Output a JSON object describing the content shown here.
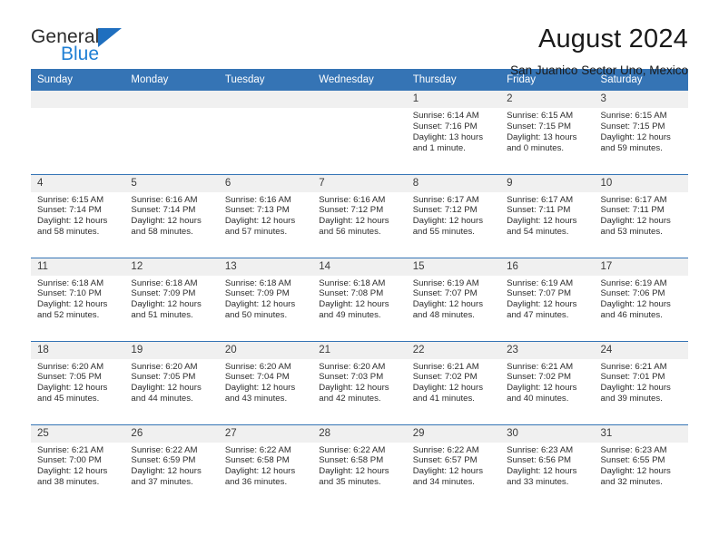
{
  "brand": {
    "line1": "General",
    "line2": "Blue",
    "flag_color": "#1f6fbf",
    "blue_text_color": "#1f7fd4"
  },
  "header": {
    "title": "August 2024",
    "subtitle": "San Juanico Sector Uno, Mexico"
  },
  "theme": {
    "header_blue": "#3574b5",
    "daynum_gray": "#f0f0f0"
  },
  "weekday_headers": [
    "Sunday",
    "Monday",
    "Tuesday",
    "Wednesday",
    "Thursday",
    "Friday",
    "Saturday"
  ],
  "weeks": [
    [
      {
        "day": "",
        "empty": true,
        "sunrise": "",
        "sunset": "",
        "daylight1": "",
        "daylight2": ""
      },
      {
        "day": "",
        "empty": true,
        "sunrise": "",
        "sunset": "",
        "daylight1": "",
        "daylight2": ""
      },
      {
        "day": "",
        "empty": true,
        "sunrise": "",
        "sunset": "",
        "daylight1": "",
        "daylight2": ""
      },
      {
        "day": "",
        "empty": true,
        "sunrise": "",
        "sunset": "",
        "daylight1": "",
        "daylight2": ""
      },
      {
        "day": "1",
        "empty": false,
        "sunrise": "Sunrise: 6:14 AM",
        "sunset": "Sunset: 7:16 PM",
        "daylight1": "Daylight: 13 hours",
        "daylight2": "and 1 minute."
      },
      {
        "day": "2",
        "empty": false,
        "sunrise": "Sunrise: 6:15 AM",
        "sunset": "Sunset: 7:15 PM",
        "daylight1": "Daylight: 13 hours",
        "daylight2": "and 0 minutes."
      },
      {
        "day": "3",
        "empty": false,
        "sunrise": "Sunrise: 6:15 AM",
        "sunset": "Sunset: 7:15 PM",
        "daylight1": "Daylight: 12 hours",
        "daylight2": "and 59 minutes."
      }
    ],
    [
      {
        "day": "4",
        "empty": false,
        "sunrise": "Sunrise: 6:15 AM",
        "sunset": "Sunset: 7:14 PM",
        "daylight1": "Daylight: 12 hours",
        "daylight2": "and 58 minutes."
      },
      {
        "day": "5",
        "empty": false,
        "sunrise": "Sunrise: 6:16 AM",
        "sunset": "Sunset: 7:14 PM",
        "daylight1": "Daylight: 12 hours",
        "daylight2": "and 58 minutes."
      },
      {
        "day": "6",
        "empty": false,
        "sunrise": "Sunrise: 6:16 AM",
        "sunset": "Sunset: 7:13 PM",
        "daylight1": "Daylight: 12 hours",
        "daylight2": "and 57 minutes."
      },
      {
        "day": "7",
        "empty": false,
        "sunrise": "Sunrise: 6:16 AM",
        "sunset": "Sunset: 7:12 PM",
        "daylight1": "Daylight: 12 hours",
        "daylight2": "and 56 minutes."
      },
      {
        "day": "8",
        "empty": false,
        "sunrise": "Sunrise: 6:17 AM",
        "sunset": "Sunset: 7:12 PM",
        "daylight1": "Daylight: 12 hours",
        "daylight2": "and 55 minutes."
      },
      {
        "day": "9",
        "empty": false,
        "sunrise": "Sunrise: 6:17 AM",
        "sunset": "Sunset: 7:11 PM",
        "daylight1": "Daylight: 12 hours",
        "daylight2": "and 54 minutes."
      },
      {
        "day": "10",
        "empty": false,
        "sunrise": "Sunrise: 6:17 AM",
        "sunset": "Sunset: 7:11 PM",
        "daylight1": "Daylight: 12 hours",
        "daylight2": "and 53 minutes."
      }
    ],
    [
      {
        "day": "11",
        "empty": false,
        "sunrise": "Sunrise: 6:18 AM",
        "sunset": "Sunset: 7:10 PM",
        "daylight1": "Daylight: 12 hours",
        "daylight2": "and 52 minutes."
      },
      {
        "day": "12",
        "empty": false,
        "sunrise": "Sunrise: 6:18 AM",
        "sunset": "Sunset: 7:09 PM",
        "daylight1": "Daylight: 12 hours",
        "daylight2": "and 51 minutes."
      },
      {
        "day": "13",
        "empty": false,
        "sunrise": "Sunrise: 6:18 AM",
        "sunset": "Sunset: 7:09 PM",
        "daylight1": "Daylight: 12 hours",
        "daylight2": "and 50 minutes."
      },
      {
        "day": "14",
        "empty": false,
        "sunrise": "Sunrise: 6:18 AM",
        "sunset": "Sunset: 7:08 PM",
        "daylight1": "Daylight: 12 hours",
        "daylight2": "and 49 minutes."
      },
      {
        "day": "15",
        "empty": false,
        "sunrise": "Sunrise: 6:19 AM",
        "sunset": "Sunset: 7:07 PM",
        "daylight1": "Daylight: 12 hours",
        "daylight2": "and 48 minutes."
      },
      {
        "day": "16",
        "empty": false,
        "sunrise": "Sunrise: 6:19 AM",
        "sunset": "Sunset: 7:07 PM",
        "daylight1": "Daylight: 12 hours",
        "daylight2": "and 47 minutes."
      },
      {
        "day": "17",
        "empty": false,
        "sunrise": "Sunrise: 6:19 AM",
        "sunset": "Sunset: 7:06 PM",
        "daylight1": "Daylight: 12 hours",
        "daylight2": "and 46 minutes."
      }
    ],
    [
      {
        "day": "18",
        "empty": false,
        "sunrise": "Sunrise: 6:20 AM",
        "sunset": "Sunset: 7:05 PM",
        "daylight1": "Daylight: 12 hours",
        "daylight2": "and 45 minutes."
      },
      {
        "day": "19",
        "empty": false,
        "sunrise": "Sunrise: 6:20 AM",
        "sunset": "Sunset: 7:05 PM",
        "daylight1": "Daylight: 12 hours",
        "daylight2": "and 44 minutes."
      },
      {
        "day": "20",
        "empty": false,
        "sunrise": "Sunrise: 6:20 AM",
        "sunset": "Sunset: 7:04 PM",
        "daylight1": "Daylight: 12 hours",
        "daylight2": "and 43 minutes."
      },
      {
        "day": "21",
        "empty": false,
        "sunrise": "Sunrise: 6:20 AM",
        "sunset": "Sunset: 7:03 PM",
        "daylight1": "Daylight: 12 hours",
        "daylight2": "and 42 minutes."
      },
      {
        "day": "22",
        "empty": false,
        "sunrise": "Sunrise: 6:21 AM",
        "sunset": "Sunset: 7:02 PM",
        "daylight1": "Daylight: 12 hours",
        "daylight2": "and 41 minutes."
      },
      {
        "day": "23",
        "empty": false,
        "sunrise": "Sunrise: 6:21 AM",
        "sunset": "Sunset: 7:02 PM",
        "daylight1": "Daylight: 12 hours",
        "daylight2": "and 40 minutes."
      },
      {
        "day": "24",
        "empty": false,
        "sunrise": "Sunrise: 6:21 AM",
        "sunset": "Sunset: 7:01 PM",
        "daylight1": "Daylight: 12 hours",
        "daylight2": "and 39 minutes."
      }
    ],
    [
      {
        "day": "25",
        "empty": false,
        "sunrise": "Sunrise: 6:21 AM",
        "sunset": "Sunset: 7:00 PM",
        "daylight1": "Daylight: 12 hours",
        "daylight2": "and 38 minutes."
      },
      {
        "day": "26",
        "empty": false,
        "sunrise": "Sunrise: 6:22 AM",
        "sunset": "Sunset: 6:59 PM",
        "daylight1": "Daylight: 12 hours",
        "daylight2": "and 37 minutes."
      },
      {
        "day": "27",
        "empty": false,
        "sunrise": "Sunrise: 6:22 AM",
        "sunset": "Sunset: 6:58 PM",
        "daylight1": "Daylight: 12 hours",
        "daylight2": "and 36 minutes."
      },
      {
        "day": "28",
        "empty": false,
        "sunrise": "Sunrise: 6:22 AM",
        "sunset": "Sunset: 6:58 PM",
        "daylight1": "Daylight: 12 hours",
        "daylight2": "and 35 minutes."
      },
      {
        "day": "29",
        "empty": false,
        "sunrise": "Sunrise: 6:22 AM",
        "sunset": "Sunset: 6:57 PM",
        "daylight1": "Daylight: 12 hours",
        "daylight2": "and 34 minutes."
      },
      {
        "day": "30",
        "empty": false,
        "sunrise": "Sunrise: 6:23 AM",
        "sunset": "Sunset: 6:56 PM",
        "daylight1": "Daylight: 12 hours",
        "daylight2": "and 33 minutes."
      },
      {
        "day": "31",
        "empty": false,
        "sunrise": "Sunrise: 6:23 AM",
        "sunset": "Sunset: 6:55 PM",
        "daylight1": "Daylight: 12 hours",
        "daylight2": "and 32 minutes."
      }
    ]
  ]
}
